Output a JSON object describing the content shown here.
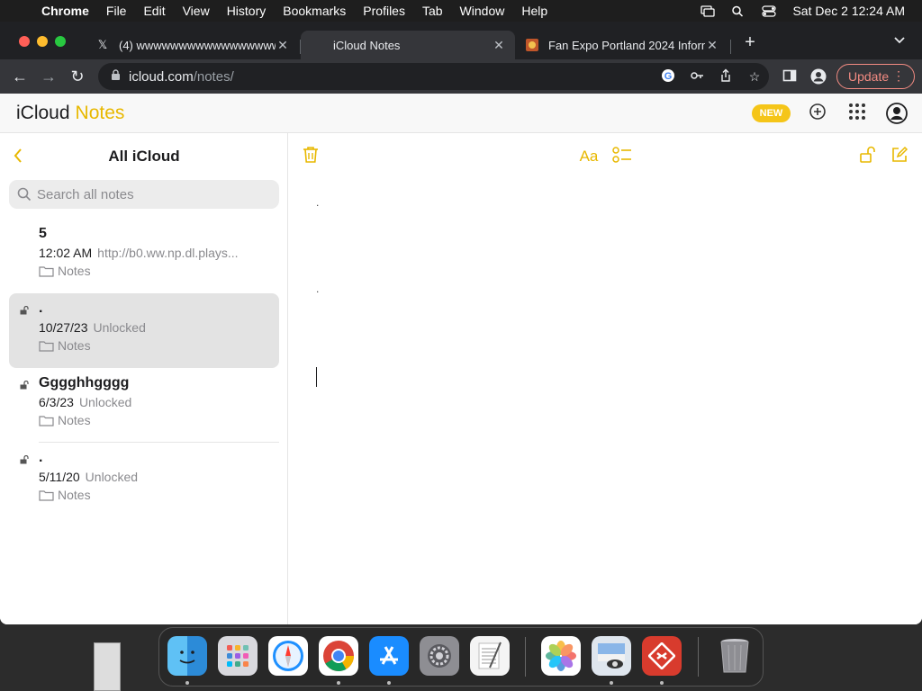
{
  "menubar": {
    "app_name": "Chrome",
    "menus": [
      "File",
      "Edit",
      "View",
      "History",
      "Bookmarks",
      "Profiles",
      "Tab",
      "Window",
      "Help"
    ],
    "datetime": "Sat Dec 2  12:24 AM"
  },
  "tabs": [
    {
      "title": "(4) wwwwwwwwwwwwwwwwwwwwwww",
      "favicon": "x-logo-icon"
    },
    {
      "title": "iCloud Notes",
      "favicon": "apple-icon"
    },
    {
      "title": "Fan Expo Portland 2024 Inform",
      "favicon": "site-icon"
    }
  ],
  "toolbar": {
    "url_host": "icloud.com",
    "url_path": "/notes/",
    "update_label": "Update"
  },
  "icloud": {
    "brand_icloud": "iCloud",
    "brand_notes": "Notes",
    "new_badge": "NEW"
  },
  "sidebar": {
    "title": "All iCloud",
    "search_placeholder": "Search all notes",
    "notes": [
      {
        "title": "5",
        "date": "12:02 AM",
        "snippet": "http://b0.ww.np.dl.plays...",
        "folder": "Notes",
        "locked": false,
        "selected": false
      },
      {
        "title": ".",
        "date": "10/27/23",
        "snippet": "Unlocked",
        "folder": "Notes",
        "locked": true,
        "selected": true
      },
      {
        "title": "Gggghhgggg",
        "date": "6/3/23",
        "snippet": "Unlocked",
        "folder": "Notes",
        "locked": true,
        "selected": false
      },
      {
        "title": ".",
        "date": "5/11/20",
        "snippet": "Unlocked",
        "folder": "Notes",
        "locked": true,
        "selected": false
      }
    ]
  },
  "editor": {
    "format_label": "Aa",
    "line1": ".",
    "line2": "."
  },
  "dock": {
    "apps": [
      "finder-icon",
      "launchpad-icon",
      "safari-icon",
      "chrome-icon",
      "app-store-icon",
      "system-settings-icon",
      "textedit-icon",
      "photos-icon",
      "preview-icon",
      "remote-desktop-icon",
      "trash-icon"
    ]
  },
  "colors": {
    "accent": "#e8b800",
    "update": "#f28b82"
  }
}
